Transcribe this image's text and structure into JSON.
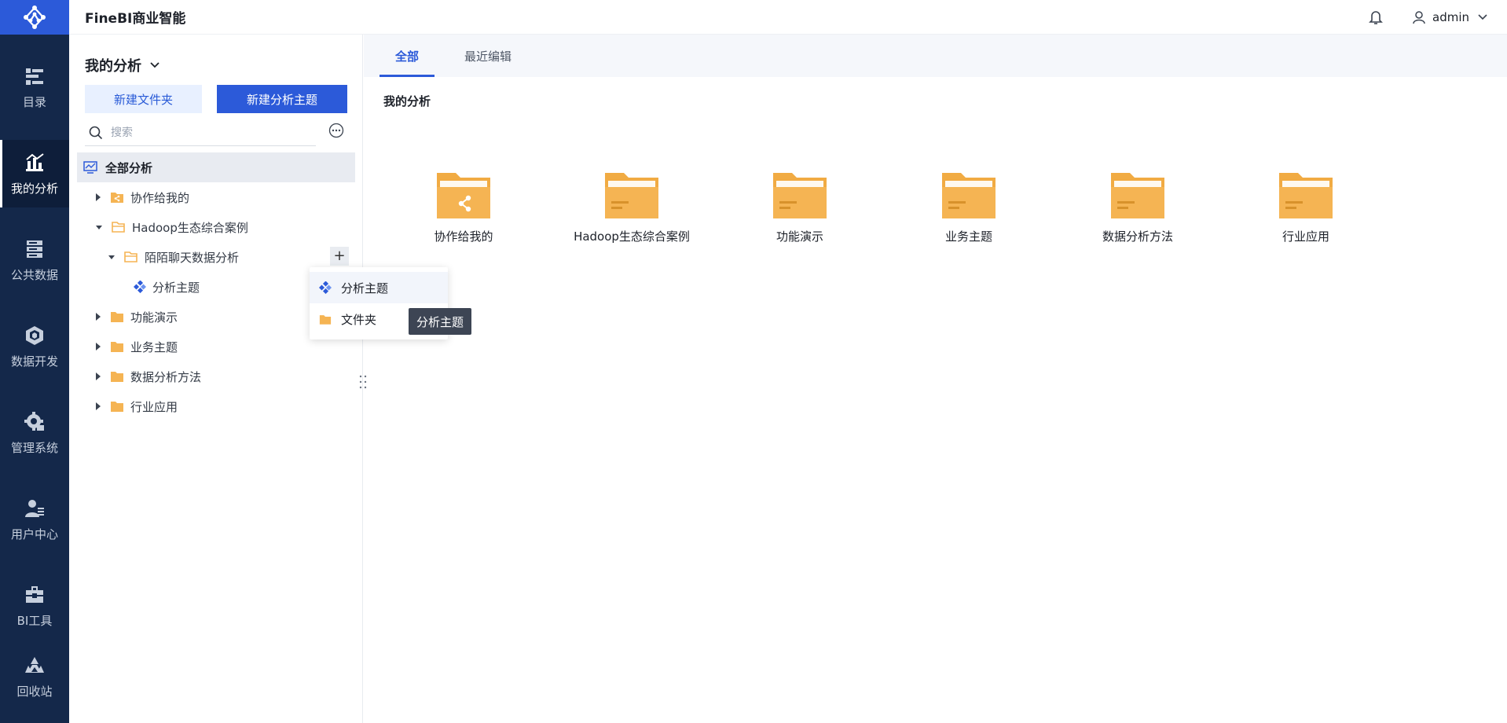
{
  "header": {
    "app_title": "FineBI商业智能",
    "user_name": "admin"
  },
  "rail": {
    "items": [
      {
        "label": "目录"
      },
      {
        "label": "我的分析"
      },
      {
        "label": "公共数据"
      },
      {
        "label": "数据开发"
      },
      {
        "label": "管理系统"
      },
      {
        "label": "用户中心"
      },
      {
        "label": "BI工具"
      },
      {
        "label": "回收站"
      }
    ]
  },
  "sidebar": {
    "title": "我的分析",
    "new_folder_label": "新建文件夹",
    "new_subject_label": "新建分析主题",
    "search_placeholder": "搜索",
    "tree": {
      "root": "全部分析",
      "items": [
        {
          "label": "协作给我的"
        },
        {
          "label": "Hadoop生态综合案例"
        },
        {
          "label": "陌陌聊天数据分析"
        },
        {
          "label": "分析主题"
        },
        {
          "label": "功能演示"
        },
        {
          "label": "业务主题"
        },
        {
          "label": "数据分析方法"
        },
        {
          "label": "行业应用"
        }
      ]
    }
  },
  "popup": {
    "items": [
      {
        "label": "分析主题"
      },
      {
        "label": "文件夹"
      }
    ],
    "tooltip": "分析主题"
  },
  "main": {
    "tabs": [
      {
        "label": "全部"
      },
      {
        "label": "最近编辑"
      }
    ],
    "section_title": "我的分析",
    "folders": [
      {
        "label": "协作给我的"
      },
      {
        "label": "Hadoop生态综合案例"
      },
      {
        "label": "功能演示"
      },
      {
        "label": "业务主题"
      },
      {
        "label": "数据分析方法"
      },
      {
        "label": "行业应用"
      }
    ]
  },
  "colors": {
    "rail_bg": "#14284a",
    "accent": "#2c5ad9",
    "folder": "#f5b453"
  }
}
